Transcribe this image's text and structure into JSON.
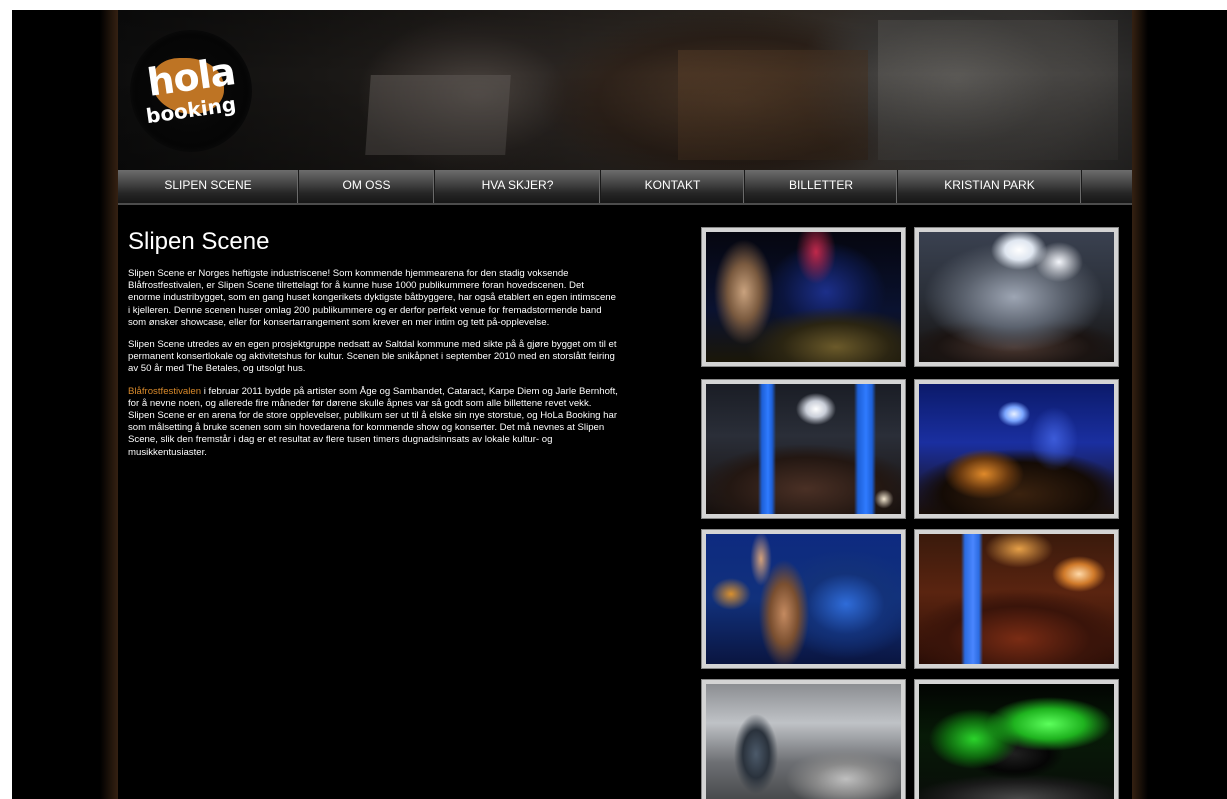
{
  "logo": {
    "line1": "hola",
    "line2": "booking"
  },
  "nav": {
    "items": [
      {
        "label": "SLIPEN SCENE"
      },
      {
        "label": "OM OSS"
      },
      {
        "label": "HVA SKJER?"
      },
      {
        "label": "KONTAKT"
      },
      {
        "label": "BILLETTER"
      },
      {
        "label": "KRISTIAN PARK"
      }
    ]
  },
  "content": {
    "title": "Slipen Scene",
    "p1": "Slipen Scene er Norges heftigste industriscene! Som kommende hjemmearena for den stadig voksende Blåfrostfestivalen, er Slipen Scene tilrettelagt for å kunne huse 1000 publikummere foran hovedscenen. Det enorme industribygget, som en gang huset kongerikets dyktigste båtbyggere, har også etablert en egen intimscene i kjelleren. Denne scenen huser omlag 200 publikummere og er derfor perfekt venue for fremadstormende band som ønsker showcase, eller for konsertarrangement som krever en mer intim og tett på-opplevelse.",
    "p2": "Slipen Scene utredes av en egen prosjektgruppe nedsatt av Saltdal kommune med sikte på å gjøre bygget om til et permanent konsertlokale og aktivitetshus for kultur. Scenen ble snikåpnet i september 2010 med en storslått feiring av 50 år med The Betales, og utsolgt hus.",
    "p3_link": "Blåfrostfestivalen",
    "p3_rest": " i februar 2011 bydde på artister som Åge og Sambandet, Cataract, Karpe Diem og Jarle Bernhoft, for å nevne noen, og allerede fire måneder før dørene skulle åpnes var så godt som alle billettene revet vekk. Slipen Scene er en arena for de store opplevelser, publikum ser ut til å elske sin nye storstue, og HoLa Booking har som målsetting å bruke scenen som sin hovedarena for kommende show og konserter. Det må nevnes at Slipen Scene, slik den fremstår i dag er et resultat av flere tusen timers dugnadsinnsats av lokale kultur- og musikkentusiaster."
  },
  "gallery": {
    "photos": [
      {
        "subject": "singer-on-stage"
      },
      {
        "subject": "band-in-smoke"
      },
      {
        "subject": "crowd-blue-pillars"
      },
      {
        "subject": "blue-light-show"
      },
      {
        "subject": "singer-raised-fist"
      },
      {
        "subject": "crowd-stage-lights"
      },
      {
        "subject": "workers-in-hall"
      },
      {
        "subject": "green-building-stage"
      }
    ]
  },
  "colors": {
    "background": "#000000",
    "accent_link": "#d98a2b",
    "text": "#ffffff",
    "photo_border": "#d4d4d4"
  }
}
